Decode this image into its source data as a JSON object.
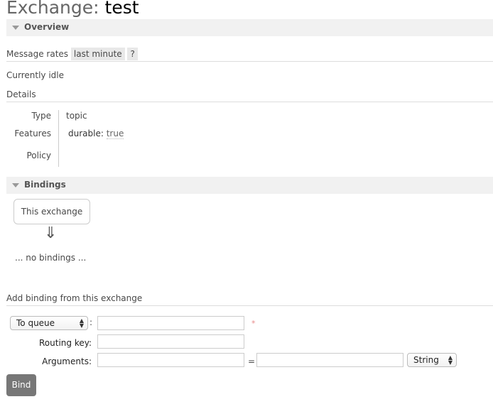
{
  "header": {
    "title_prefix": "Exchange:",
    "title_name": "test"
  },
  "overview": {
    "section_label": "Overview",
    "message_rates_label": "Message rates",
    "rate_range": "last minute",
    "help": "?",
    "status": "Currently idle",
    "details_label": "Details",
    "details": [
      {
        "key": "Type",
        "value": "topic"
      },
      {
        "key": "Features",
        "feature_name": "durable:",
        "feature_value": "true"
      },
      {
        "key": "Policy",
        "value": ""
      }
    ]
  },
  "bindings": {
    "section_label": "Bindings",
    "source_box": "This exchange",
    "arrow": "⇓",
    "empty_text": "... no bindings ..."
  },
  "add_binding": {
    "heading": "Add binding from this exchange",
    "destination_type": "To queue",
    "colon": ":",
    "required_mark": "*",
    "destination_value": "",
    "routing_key_label": "Routing key:",
    "routing_key_value": "",
    "arguments_label": "Arguments:",
    "arg_key": "",
    "equals": "=",
    "arg_value": "",
    "arg_type": "String",
    "bind_button": "Bind"
  },
  "colors": {
    "required": "#e88a8a",
    "button": "#777777",
    "section_bar": "#f1f1f1"
  }
}
